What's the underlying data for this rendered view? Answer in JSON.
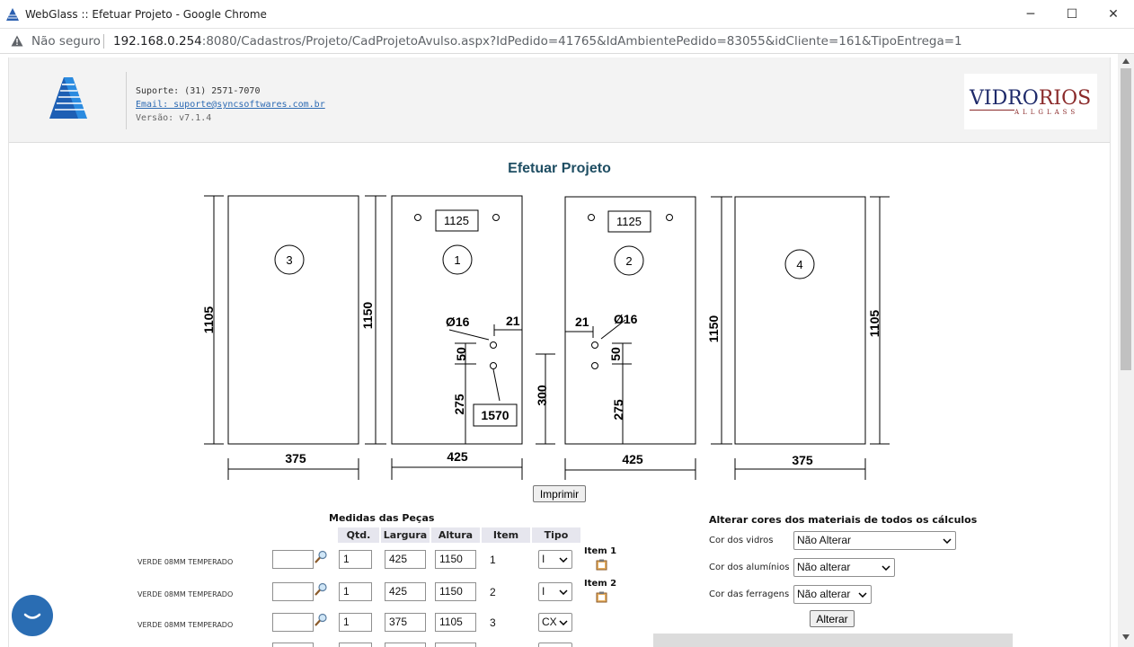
{
  "window": {
    "title": "WebGlass :: Efetuar Projeto - Google Chrome",
    "minimize": "─",
    "maximize": "☐",
    "close": "✕"
  },
  "address": {
    "security": "Não seguro",
    "host": "192.168.0.254",
    "path": ":8080/Cadastros/Projeto/CadProjetoAvulso.aspx?IdPedido=41765&IdAmbientePedido=83055&idCliente=161&TipoEntrega=1"
  },
  "header": {
    "support": "Suporte: (31) 2571-7070",
    "email": "Email: suporte@syncsoftwares.com.br",
    "version": "Versão: v7.1.4",
    "brand_main_a": "VIDRO",
    "brand_main_b": "RIOS",
    "brand_sub": "ALLGLASS"
  },
  "page": {
    "title": "Efetuar Projeto",
    "print_button": "Imprimir"
  },
  "drawing": {
    "panel3": {
      "number": "3",
      "width": "375",
      "height": "1105"
    },
    "panel1": {
      "number": "1",
      "width": "425",
      "height": "1150",
      "label_top": "1125",
      "hole_diameter": "Ø16",
      "hole_offset": "21",
      "hole_spacing": "50",
      "hole_height": "275",
      "label_mid": "1570"
    },
    "panel2": {
      "number": "2",
      "width": "425",
      "height": "1150",
      "label_top": "1125",
      "hole_diameter": "Ø16",
      "hole_offset": "21",
      "hole_spacing": "50",
      "hole_height": "275"
    },
    "panel4": {
      "number": "4",
      "width": "375",
      "height": "1105"
    },
    "gap": "300"
  },
  "pieces": {
    "title": "Medidas das Peças",
    "headers": {
      "qty": "Qtd.",
      "width": "Largura",
      "height": "Altura",
      "item": "Item",
      "type": "Tipo"
    },
    "rows": [
      {
        "material": "VERDE 08MM TEMPERADO",
        "qty": "1",
        "width": "425",
        "height": "1150",
        "item": "1",
        "type": "I",
        "item_label": "Item 1"
      },
      {
        "material": "VERDE 08MM TEMPERADO",
        "qty": "1",
        "width": "425",
        "height": "1150",
        "item": "2",
        "type": "I",
        "item_label": "Item 2"
      },
      {
        "material": "VERDE 08MM TEMPERADO",
        "qty": "1",
        "width": "375",
        "height": "1105",
        "item": "3",
        "type": "CX",
        "item_label": ""
      }
    ]
  },
  "colors": {
    "title": "Alterar cores dos materiais de todos os cálculos",
    "glass_label": "Cor dos vidros",
    "glass_value": "Não Alterar",
    "alum_label": "Cor dos alumínios",
    "alum_value": "Não alterar",
    "hardware_label": "Cor das ferragens",
    "hardware_value": "Não alterar",
    "apply_button": "Alterar"
  }
}
